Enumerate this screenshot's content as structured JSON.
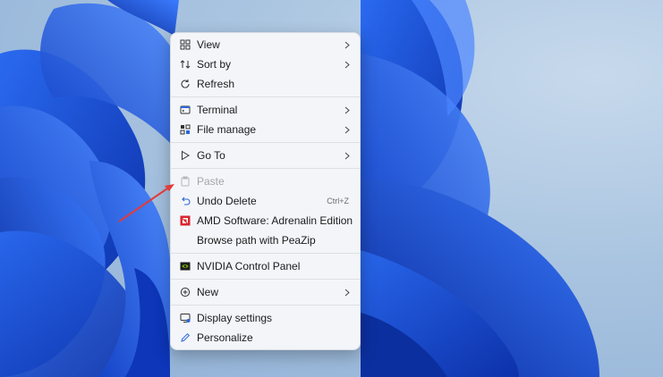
{
  "menu": {
    "items": [
      {
        "label": "View",
        "icon": "grid-icon",
        "submenu": true
      },
      {
        "label": "Sort by",
        "icon": "sort-icon",
        "submenu": true
      },
      {
        "label": "Refresh",
        "icon": "refresh-icon",
        "submenu": false
      },
      {
        "label": "Terminal",
        "icon": "terminal-icon",
        "submenu": true
      },
      {
        "label": "File manage",
        "icon": "file-manage-icon",
        "submenu": true
      },
      {
        "label": "Go To",
        "icon": "play-icon",
        "submenu": true
      },
      {
        "label": "Paste",
        "icon": "paste-icon",
        "disabled": true
      },
      {
        "label": "Undo Delete",
        "icon": "undo-icon",
        "shortcut": "Ctrl+Z"
      },
      {
        "label": "AMD Software: Adrenalin Edition",
        "icon": "amd-icon"
      },
      {
        "label": "Browse path with PeaZip",
        "icon": ""
      },
      {
        "label": "NVIDIA Control Panel",
        "icon": "nvidia-icon"
      },
      {
        "label": "New",
        "icon": "plus-circle-icon",
        "submenu": true
      },
      {
        "label": "Display settings",
        "icon": "display-icon"
      },
      {
        "label": "Personalize",
        "icon": "pen-icon"
      }
    ]
  },
  "colors": {
    "accent_red": "#e23b3b",
    "wallpaper_blue": "#1a4fd6"
  }
}
